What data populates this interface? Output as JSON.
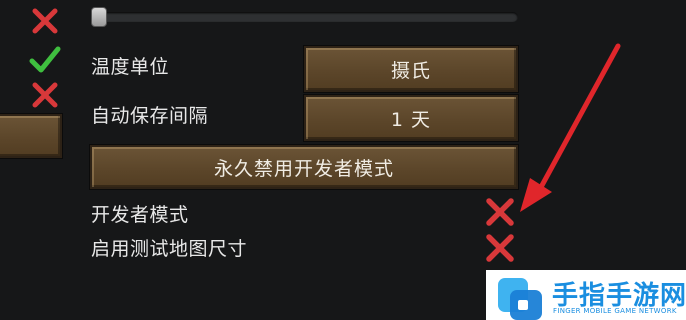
{
  "settings": {
    "temperature_unit": {
      "label": "温度单位",
      "value": "摄氏"
    },
    "autosave_interval": {
      "label": "自动保存间隔",
      "value": "1 天"
    },
    "disable_dev_mode_button": "永久禁用开发者模式",
    "dev_mode": {
      "label": "开发者模式",
      "enabled": false
    },
    "test_map_sizes": {
      "label": "启用测试地图尺寸",
      "enabled": false
    }
  },
  "slider": {
    "value": 0
  },
  "left_toggles": [
    false,
    true,
    false
  ],
  "annotation": {
    "color": "#e0262b"
  },
  "watermark": {
    "name": "手指手游网",
    "tagline": "FINGER MOBILE GAME NETWORK"
  },
  "colors": {
    "background": "#161718",
    "button_wood": "#5b4529",
    "check_green": "#3fbf3f",
    "cross_red": "#d8383a",
    "brand_blue": "#1a8ee0"
  },
  "icons": [
    "cross-icon",
    "check-icon",
    "arrow-annotation",
    "watermark-logo"
  ]
}
